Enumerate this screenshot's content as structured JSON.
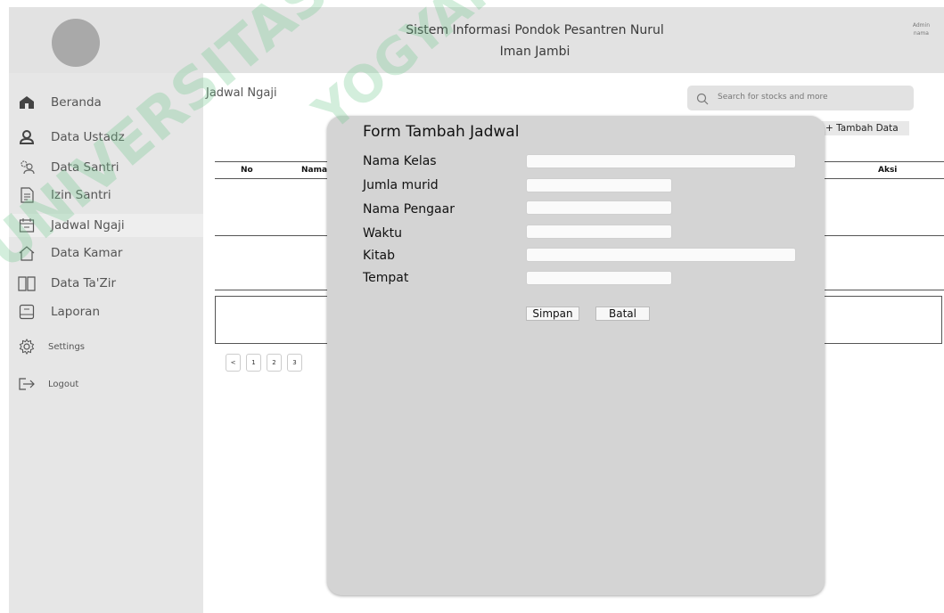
{
  "header": {
    "title_line1": "Sistem Informasi Pondok Pesantren Nurul",
    "title_line2": "Iman Jambi",
    "admin_line1": "Admin",
    "admin_line2": "nama"
  },
  "sidebar": {
    "items": [
      {
        "label": "Beranda",
        "icon": "home-icon"
      },
      {
        "label": "Data Ustadz",
        "icon": "user-icon"
      },
      {
        "label": "Data Santri",
        "icon": "users-icon"
      },
      {
        "label": "Izin Santri",
        "icon": "document-icon"
      },
      {
        "label": "Jadwal Ngaji",
        "icon": "calendar-icon",
        "active": true
      },
      {
        "label": "Data Kamar",
        "icon": "house-outline-icon"
      },
      {
        "label": "Data Ta'Zir",
        "icon": "book-icon"
      },
      {
        "label": "Laporan",
        "icon": "report-icon"
      },
      {
        "label": "Settings",
        "icon": "gear-icon"
      },
      {
        "label": "Logout",
        "icon": "logout-icon"
      }
    ]
  },
  "main": {
    "breadcrumb": "Jadwal Ngaji",
    "search_placeholder": "Search for stocks and more",
    "add_button": "+ Tambah Data",
    "table_headers": {
      "no": "No",
      "nama": "Nama",
      "aksi": "Aksi"
    },
    "pagination": [
      "<",
      "1",
      "2",
      "3"
    ]
  },
  "modal": {
    "title": "Form Tambah Jadwal",
    "fields": [
      {
        "label": "Nama Kelas",
        "value": ""
      },
      {
        "label": "Jumla murid",
        "value": ""
      },
      {
        "label": "Nama Pengaar",
        "value": ""
      },
      {
        "label": "Waktu",
        "value": ""
      },
      {
        "label": "Kitab",
        "value": ""
      },
      {
        "label": "Tempat",
        "value": ""
      }
    ],
    "save_label": "Simpan",
    "cancel_label": "Batal"
  },
  "watermark": {
    "line1": "UNIVERSITAS JENDERAL",
    "line2": "YOGYAKARTA"
  }
}
